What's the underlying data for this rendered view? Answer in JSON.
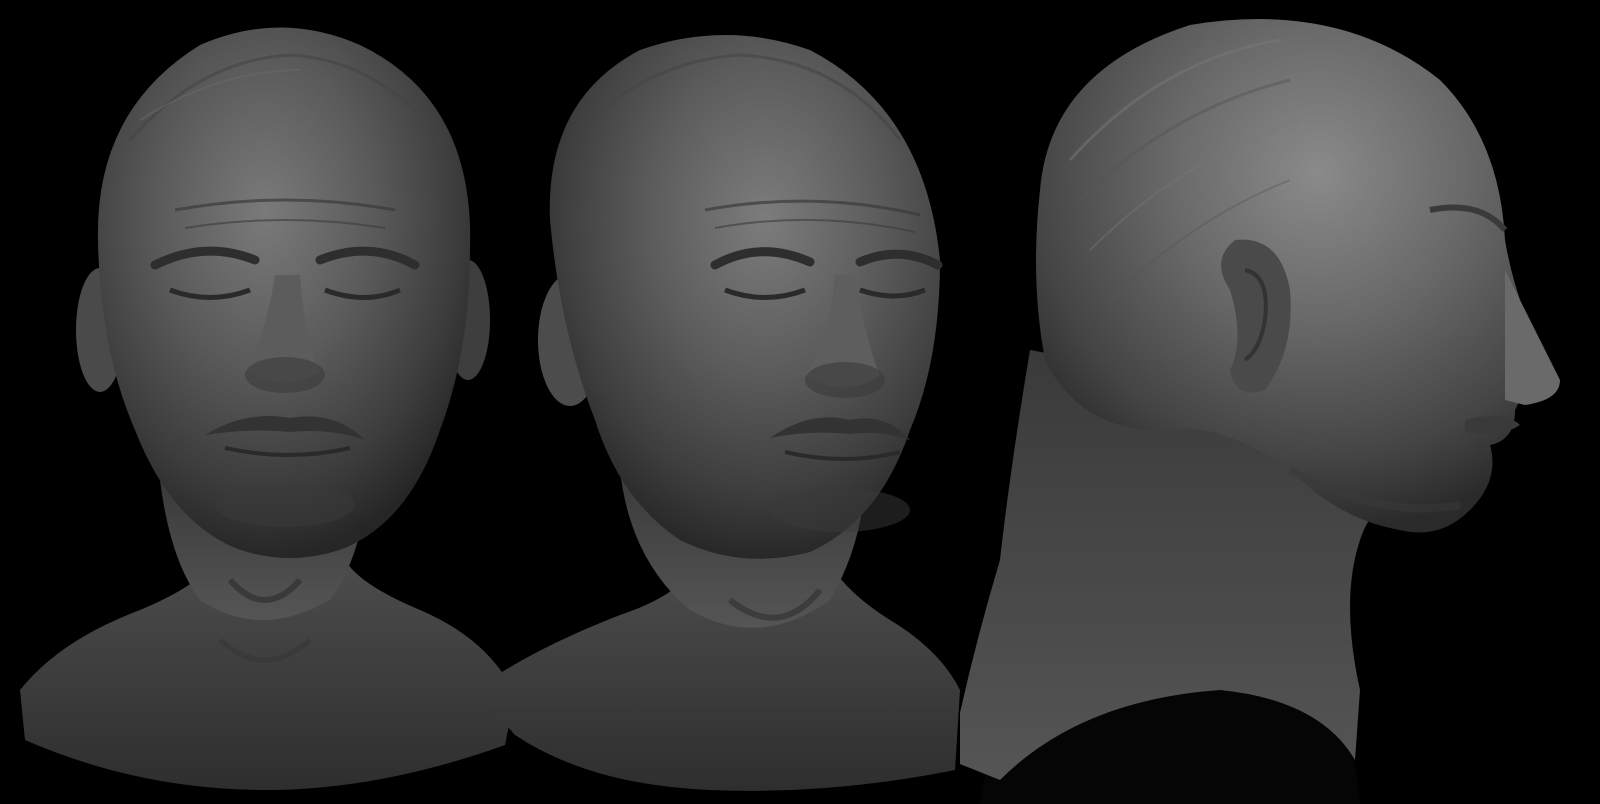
{
  "scene": {
    "background_color": "#000000",
    "material_color": "#5e5e5e",
    "views": [
      {
        "id": "front",
        "name": "front-view"
      },
      {
        "id": "three_quarter",
        "name": "three-quarter-view"
      },
      {
        "id": "profile",
        "name": "profile-view"
      }
    ]
  }
}
